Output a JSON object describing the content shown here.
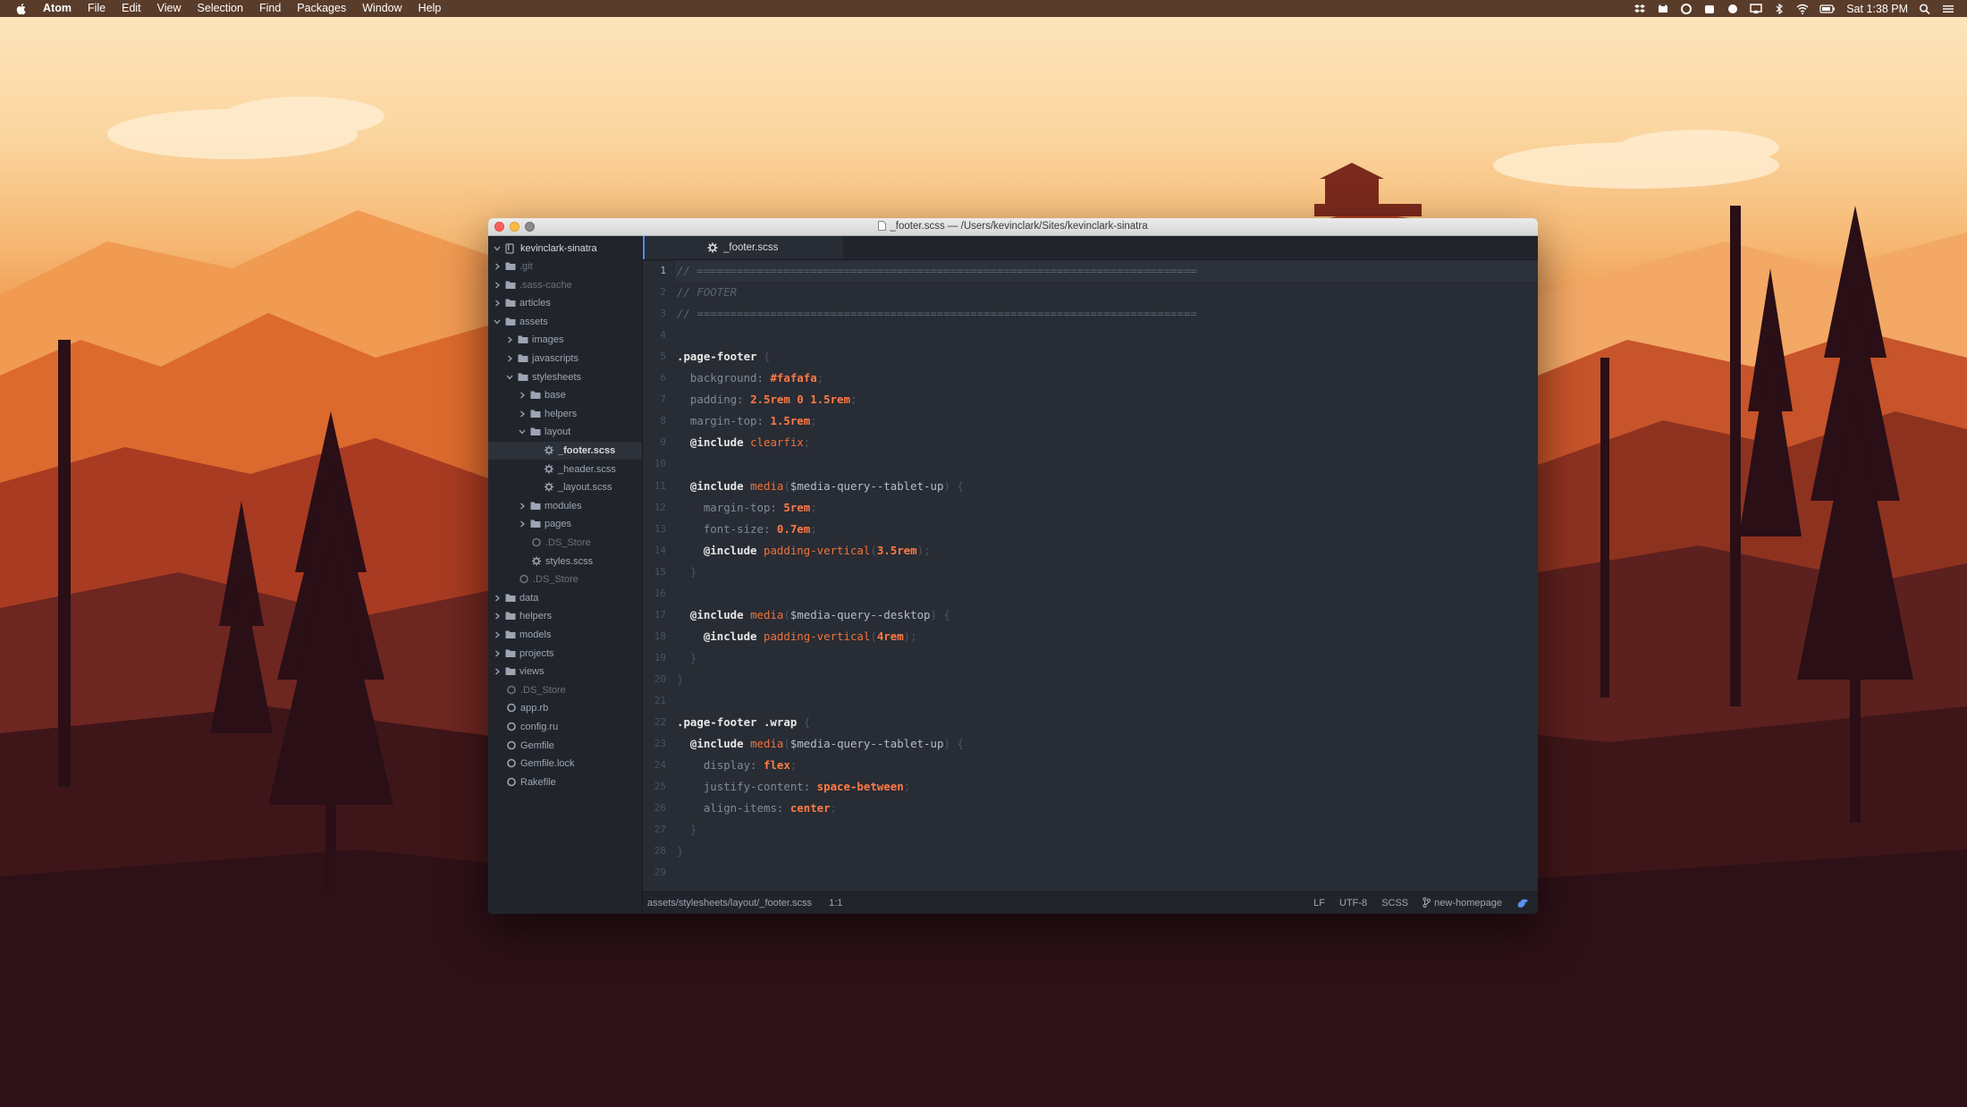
{
  "menubar": {
    "items": [
      "Atom",
      "File",
      "Edit",
      "View",
      "Selection",
      "Find",
      "Packages",
      "Window",
      "Help"
    ],
    "clock": "Sat 1:38 PM"
  },
  "window": {
    "title": "_footer.scss — /Users/kevinclark/Sites/kevinclark-sinatra"
  },
  "tree": {
    "root": "kevinclark-sinatra",
    "rows": [
      {
        "label": ".git",
        "type": "folder",
        "dim": true
      },
      {
        "label": ".sass-cache",
        "type": "folder",
        "dim": true
      },
      {
        "label": "articles",
        "type": "folder"
      },
      {
        "label": "assets",
        "type": "folder",
        "open": true
      },
      {
        "label": "images",
        "type": "folder"
      },
      {
        "label": "javascripts",
        "type": "folder"
      },
      {
        "label": "stylesheets",
        "type": "folder",
        "open": true
      },
      {
        "label": "base",
        "type": "folder"
      },
      {
        "label": "helpers",
        "type": "folder"
      },
      {
        "label": "layout",
        "type": "folder",
        "open": true
      },
      {
        "label": "_footer.scss",
        "type": "scss",
        "selected": true
      },
      {
        "label": "_header.scss",
        "type": "scss"
      },
      {
        "label": "_layout.scss",
        "type": "scss"
      },
      {
        "label": "modules",
        "type": "folder"
      },
      {
        "label": "pages",
        "type": "folder"
      },
      {
        "label": ".DS_Store",
        "type": "file",
        "dim": true
      },
      {
        "label": "styles.scss",
        "type": "scss"
      },
      {
        "label": ".DS_Store",
        "type": "file",
        "dim": true
      },
      {
        "label": "data",
        "type": "folder"
      },
      {
        "label": "helpers",
        "type": "folder"
      },
      {
        "label": "models",
        "type": "folder"
      },
      {
        "label": "projects",
        "type": "folder"
      },
      {
        "label": "views",
        "type": "folder"
      },
      {
        "label": ".DS_Store",
        "type": "file",
        "dim": true
      },
      {
        "label": "app.rb",
        "type": "file"
      },
      {
        "label": "config.ru",
        "type": "file"
      },
      {
        "label": "Gemfile",
        "type": "file"
      },
      {
        "label": "Gemfile.lock",
        "type": "file"
      },
      {
        "label": "Rakefile",
        "type": "file"
      }
    ]
  },
  "tab": {
    "label": "_footer.scss"
  },
  "code": [
    "// ===========================================================================",
    "// FOOTER",
    "// ===========================================================================",
    "",
    ".page-footer {",
    "  background: #fafafa;",
    "  padding: 2.5rem 0 1.5rem;",
    "  margin-top: 1.5rem;",
    "  @include clearfix;",
    "",
    "  @include media($media-query--tablet-up) {",
    "    margin-top: 5rem;",
    "    font-size: 0.7em;",
    "    @include padding-vertical(3.5rem);",
    "  }",
    "",
    "  @include media($media-query--desktop) {",
    "    @include padding-vertical(4rem);",
    "  }",
    "}",
    "",
    ".page-footer .wrap {",
    "  @include media($media-query--tablet-up) {",
    "    display: flex;",
    "    justify-content: space-between;",
    "    align-items: center;",
    "  }",
    "}",
    ""
  ],
  "status": {
    "path": "assets/stylesheets/layout/_footer.scss",
    "cursor": "1:1",
    "line_ending": "LF",
    "encoding": "UTF-8",
    "grammar": "SCSS",
    "branch": "new-homepage"
  },
  "colors": {
    "accent": "#528bff",
    "value_orange": "#ff7a45",
    "editor_bg": "#282c34",
    "panel_bg": "#21252b"
  }
}
